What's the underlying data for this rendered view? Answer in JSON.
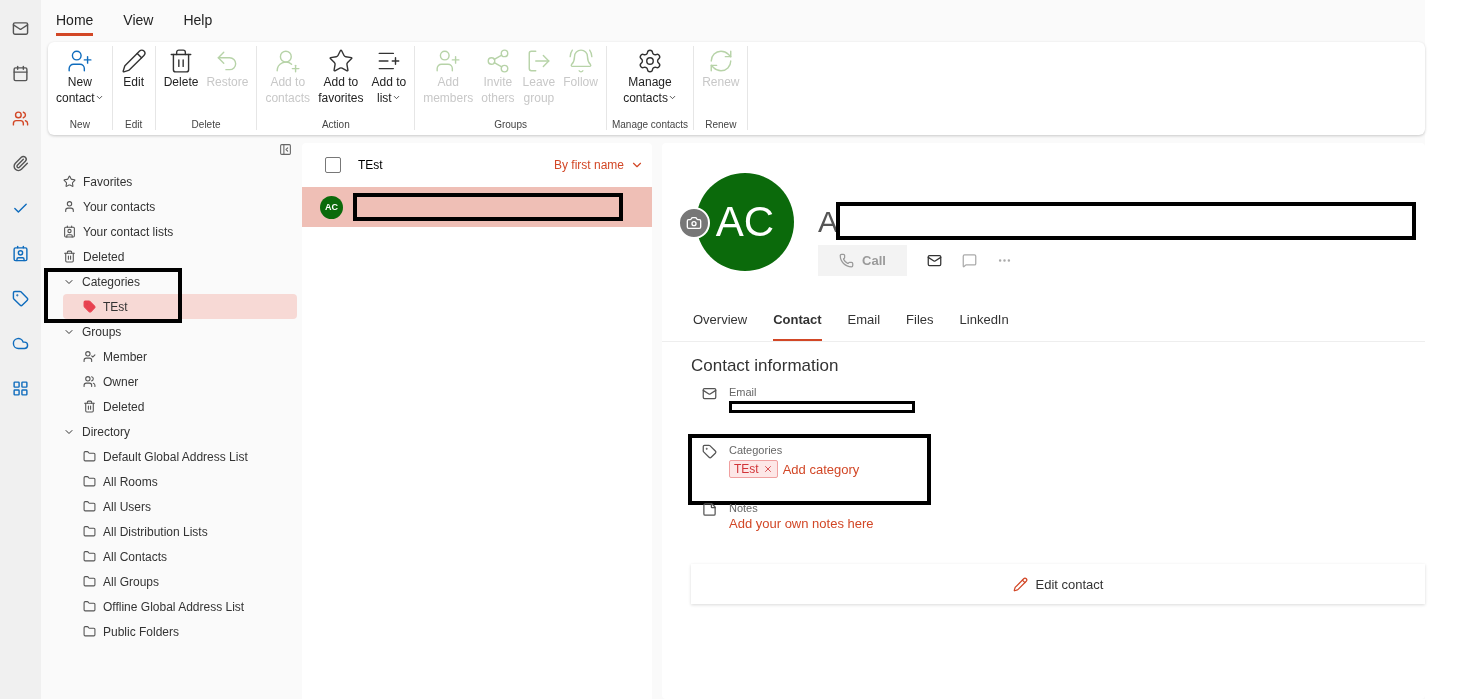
{
  "ribbon": {
    "tabs": [
      {
        "label": "Home",
        "selected": true
      },
      {
        "label": "View",
        "selected": false
      },
      {
        "label": "Help",
        "selected": false
      }
    ],
    "groups": [
      {
        "name": "New",
        "buttons": [
          {
            "lines": [
              "New",
              "contact"
            ],
            "disabled": false,
            "dropdown": true
          }
        ]
      },
      {
        "name": "Edit",
        "buttons": [
          {
            "lines": [
              "Edit"
            ],
            "disabled": false,
            "dropdown": false
          }
        ]
      },
      {
        "name": "Delete",
        "buttons": [
          {
            "lines": [
              "Delete"
            ],
            "disabled": false,
            "dropdown": false
          },
          {
            "lines": [
              "Restore"
            ],
            "disabled": true,
            "dropdown": false
          }
        ]
      },
      {
        "name": "Action",
        "buttons": [
          {
            "lines": [
              "Add to",
              "contacts"
            ],
            "disabled": true,
            "dropdown": false
          },
          {
            "lines": [
              "Add to",
              "favorites"
            ],
            "disabled": false,
            "dropdown": false
          },
          {
            "lines": [
              "Add to",
              "list"
            ],
            "disabled": false,
            "dropdown": true
          }
        ]
      },
      {
        "name": "Groups",
        "buttons": [
          {
            "lines": [
              "Add",
              "members"
            ],
            "disabled": true,
            "dropdown": false
          },
          {
            "lines": [
              "Invite",
              "others"
            ],
            "disabled": true,
            "dropdown": false
          },
          {
            "lines": [
              "Leave",
              "group"
            ],
            "disabled": true,
            "dropdown": false
          },
          {
            "lines": [
              "Follow"
            ],
            "disabled": true,
            "dropdown": false
          }
        ]
      },
      {
        "name": "Manage contacts",
        "buttons": [
          {
            "lines": [
              "Manage",
              "contacts"
            ],
            "disabled": false,
            "dropdown": true
          }
        ]
      },
      {
        "name": "Renew",
        "buttons": [
          {
            "lines": [
              "Renew"
            ],
            "disabled": true,
            "dropdown": false
          }
        ]
      }
    ]
  },
  "sidebar": {
    "items": [
      {
        "label": "Favorites",
        "selected": false
      },
      {
        "label": "Your contacts",
        "selected": false
      },
      {
        "label": "Your contact lists",
        "selected": false
      },
      {
        "label": "Deleted",
        "selected": false
      },
      {
        "label": "Categories",
        "expanded": true,
        "children": [
          {
            "label": "TEst",
            "selected": true,
            "color": "#e8414f"
          }
        ]
      },
      {
        "label": "Groups",
        "expanded": true,
        "children": [
          {
            "label": "Member",
            "selected": false
          },
          {
            "label": "Owner",
            "selected": false
          },
          {
            "label": "Deleted",
            "selected": false
          }
        ]
      },
      {
        "label": "Directory",
        "expanded": true,
        "children": [
          {
            "label": "Default Global Address List",
            "selected": false
          },
          {
            "label": "All Rooms",
            "selected": false
          },
          {
            "label": "All Users",
            "selected": false
          },
          {
            "label": "All Distribution Lists",
            "selected": false
          },
          {
            "label": "All Contacts",
            "selected": false
          },
          {
            "label": "All Groups",
            "selected": false
          },
          {
            "label": "Offline Global Address List",
            "selected": false
          },
          {
            "label": "Public Folders",
            "selected": false
          }
        ]
      }
    ]
  },
  "contact_list": {
    "title": "TEst",
    "sort": "By first name",
    "select_all": {
      "checked": false
    },
    "rows": [
      {
        "initials": "AC",
        "selected": true
      }
    ]
  },
  "detail": {
    "initials": "AC",
    "name": "A",
    "call": {
      "label": "Call",
      "disabled": true
    },
    "tabs": [
      {
        "label": "Overview",
        "selected": false
      },
      {
        "label": "Contact",
        "selected": true
      },
      {
        "label": "Email",
        "selected": false
      },
      {
        "label": "Files",
        "selected": false
      },
      {
        "label": "LinkedIn",
        "selected": false
      }
    ],
    "section_title": "Contact information",
    "fields": [
      {
        "kind": "email",
        "label": "Email"
      },
      {
        "kind": "categories",
        "label": "Categories",
        "tags": [
          "TEst"
        ],
        "add_label": "Add category"
      },
      {
        "kind": "notes",
        "label": "Notes",
        "value": "Add your own notes here"
      }
    ],
    "edit_button": "Edit contact"
  }
}
